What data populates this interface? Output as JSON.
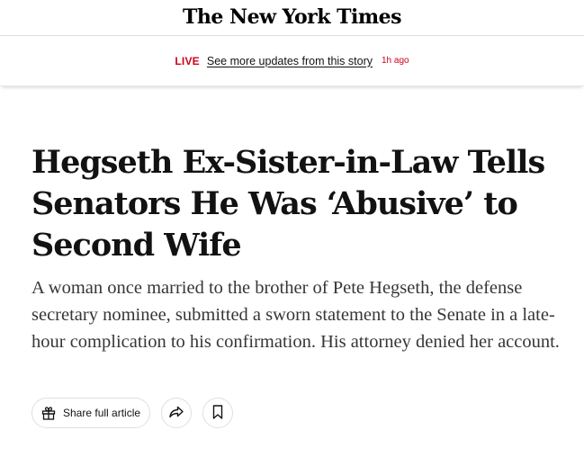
{
  "masthead": {
    "logo_text": "The New York Times",
    "logo_icon": "nyt-logo"
  },
  "live_bar": {
    "label": "LIVE",
    "link_text": "See more updates from this story",
    "time_ago": "1h ago",
    "accent_color": "#d0021b"
  },
  "article": {
    "headline": "Hegseth Ex-Sister-in-Law Tells Senators He Was ‘Abusive’ to Second Wife",
    "summary": "A woman once married to the brother of Pete Hegseth, the defense secretary nominee, submitted a sworn statement to the Senate in a late-hour complication to his confirmation. His attorney denied her account."
  },
  "actions": {
    "share_full_label": "Share full article",
    "share_full_icon": "gift-icon",
    "share_icon": "share-arrow-icon",
    "save_icon": "bookmark-icon"
  }
}
